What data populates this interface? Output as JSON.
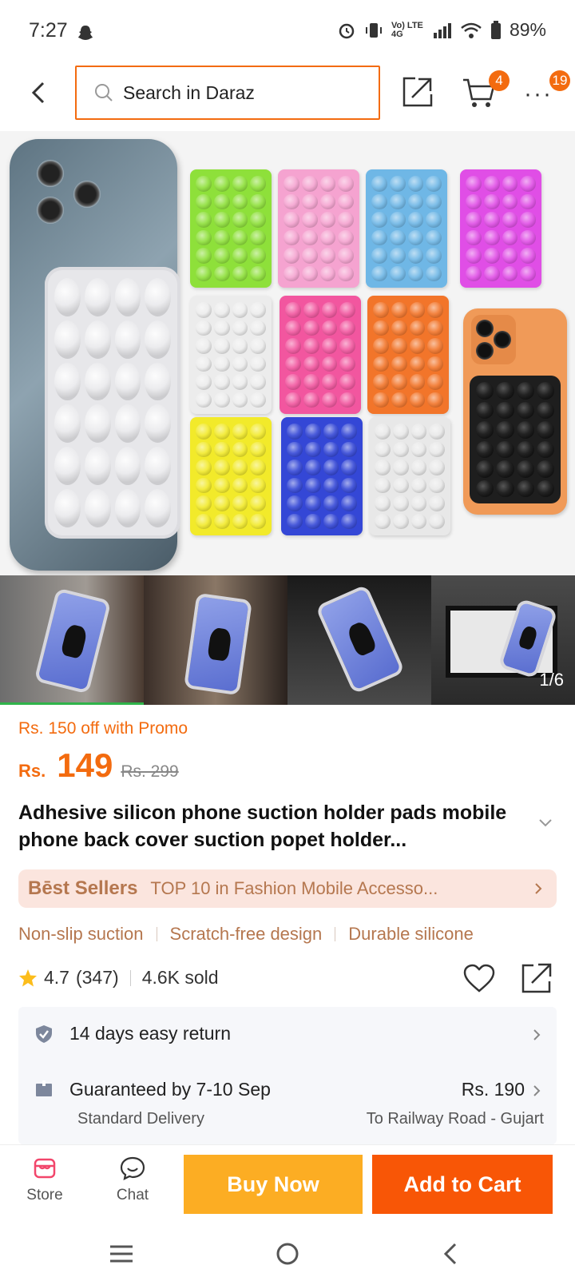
{
  "status_bar": {
    "time": "7:27",
    "network": "Vo) LTE 4G",
    "battery": "89%"
  },
  "header": {
    "search_placeholder": "Search in Daraz",
    "cart_count": "4",
    "more_count": "19"
  },
  "gallery": {
    "counter": "1/6",
    "pad_colors": [
      "#8ee03a",
      "#f5a3d0",
      "#6fb7e6",
      "#e04ee6",
      "#ececec",
      "#f2569f",
      "#f2752a",
      "#f2ea2a",
      "#3447d6",
      "#e8e8e8"
    ]
  },
  "product": {
    "promo": "Rs. 150 off with Promo",
    "currency": "Rs.",
    "price": "149",
    "original_price": "Rs. 299",
    "title": "Adhesive silicon phone suction holder pads mobile phone back cover suction popet holder...",
    "best_seller_logo": "Bēst Sellers",
    "best_seller_text": "TOP 10 in Fashion Mobile Accesso...",
    "tags": [
      "Non-slip suction",
      "Scratch-free design",
      "Durable silicone"
    ],
    "rating": "4.7",
    "reviews": "(347)",
    "sold": "4.6K sold"
  },
  "services": {
    "return_label": "14 days easy return",
    "delivery_label": "Guaranteed by 7-10 Sep",
    "delivery_price": "Rs. 190",
    "delivery_type": "Standard Delivery",
    "delivery_to": "To Railway Road - Gujart"
  },
  "bottom_bar": {
    "store": "Store",
    "chat": "Chat",
    "buy_now": "Buy Now",
    "add_to_cart": "Add to Cart"
  },
  "colors": {
    "accent": "#f36b0f",
    "buy_now": "#fcad23",
    "add_to_cart": "#f85606",
    "best_seller_bg": "#fbe5de",
    "best_seller_text": "#b5774f"
  },
  "icons": [
    "back-icon",
    "search-icon",
    "share-icon",
    "cart-icon",
    "more-icon",
    "star-icon",
    "heart-icon",
    "shield-icon",
    "delivery-icon",
    "store-icon",
    "chat-icon",
    "menu-icon",
    "home-icon",
    "nav-back-icon"
  ]
}
